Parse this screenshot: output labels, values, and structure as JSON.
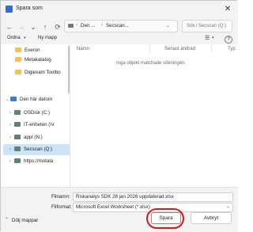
{
  "window": {
    "title": "Spara som",
    "close": "✕"
  },
  "nav": {
    "back": "←",
    "forward": "→",
    "dropdown": "⌄",
    "up": "↑",
    "breadcrumb": [
      "Den ...",
      "Secscan..."
    ],
    "breadcrumb_sep": "›",
    "refresh": "⟳",
    "search_placeholder": "Sök i Secscan (Q:)"
  },
  "toolbar": {
    "organize": "Ordna",
    "new_folder": "Ny mapp",
    "view": "☰",
    "help": "?"
  },
  "sidebar": {
    "items": [
      {
        "label": "Everon",
        "icon": "folder"
      },
      {
        "label": "Metakatalog",
        "icon": "folder"
      },
      {
        "label": "Digiexam Toolbo",
        "icon": "folder"
      },
      {
        "label": "Den här datorn",
        "icon": "pc"
      },
      {
        "label": "OSDisk (C:)",
        "icon": "drive"
      },
      {
        "label": "IT-enheten (\\\\r",
        "icon": "drive"
      },
      {
        "label": "appl (N:)",
        "icon": "drive"
      },
      {
        "label": "Secscan (Q:)",
        "icon": "drive"
      },
      {
        "label": "https://motala",
        "icon": "drive"
      }
    ]
  },
  "content": {
    "columns": [
      "Namn",
      "Senast ändrad",
      "Typ"
    ],
    "empty_message": "Inga objekt matchade sökningen."
  },
  "form": {
    "filename_label": "Filnamn:",
    "filename_value": "Riskanalys SDK 28 jan 2026  uppdaterad.xlsx",
    "filetype_label": "Filformat:",
    "filetype_value": "Microsoft Excel Worksheet (*.xlsx)",
    "hide_folders": "Dölj mappar",
    "save": "Spara",
    "cancel": "Avbryt"
  }
}
